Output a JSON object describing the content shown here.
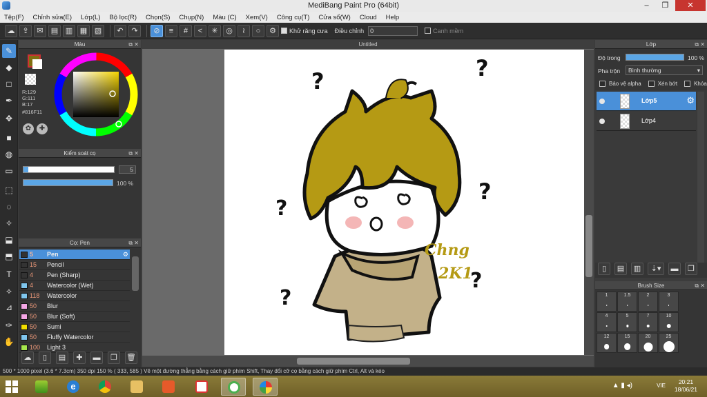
{
  "window": {
    "title": "MediBang Paint Pro (64bit)",
    "minimize": "–",
    "maximize": "❐",
    "close": "✕"
  },
  "menu": [
    "Tệp(F)",
    "Chỉnh sửa(E)",
    "Lớp(L)",
    "Bộ lọc(R)",
    "Chọn(S)",
    "Chụp(N)",
    "Màu (C)",
    "Xem(V)",
    "Công cụ(T)",
    "Cửa sổ(W)",
    "Cloud",
    "Help"
  ],
  "toolbar": {
    "antialias_label": "Khử răng cưa",
    "adjust_label": "Điều chỉnh",
    "adjust_value": "0",
    "smooth_label": "Canh mềm"
  },
  "color_panel": {
    "title": "Màu",
    "r": "R:129",
    "g": "G:111",
    "b": "B:17",
    "hex": "#816F11",
    "fg_color": "#816F11"
  },
  "brush_control": {
    "title": "Kiểm soát cọ",
    "size_value": "5",
    "opacity_value": "100 %",
    "size_fraction": 0.05,
    "opacity_fraction": 1.0
  },
  "brush_list": {
    "title": "Cọ: Pen",
    "items": [
      {
        "size": "5",
        "name": "Pen",
        "color": "#333333"
      },
      {
        "size": "15",
        "name": "Pencil",
        "color": "#333333"
      },
      {
        "size": "4",
        "name": "Pen (Sharp)",
        "color": "#333333"
      },
      {
        "size": "4",
        "name": "Watercolor (Wet)",
        "color": "#7fc6ee"
      },
      {
        "size": "118",
        "name": "Watercolor",
        "color": "#7fc6ee"
      },
      {
        "size": "50",
        "name": "Blur",
        "color": "#f4a6e6"
      },
      {
        "size": "50",
        "name": "Blur (Soft)",
        "color": "#f4a6e6"
      },
      {
        "size": "50",
        "name": "Sumi",
        "color": "#f2e000"
      },
      {
        "size": "50",
        "name": "Fluffy Watercolor",
        "color": "#7fc6ee"
      },
      {
        "size": "100",
        "name": "Light 3",
        "color": "#a7e64d"
      }
    ]
  },
  "canvas": {
    "tab_title": "Untitled",
    "signature_text": "Chng 2K1"
  },
  "layer_panel": {
    "title": "Lớp",
    "opacity_label": "Độ trong",
    "opacity_value": "100 %",
    "opacity_fraction": 1.0,
    "blend_label": "Pha trộn",
    "blend_value": "Bình thường",
    "protect_alpha": "Bảo vệ alpha",
    "clipping": "Xén bớt",
    "lock": "Khóa",
    "layers": [
      "Lớp5",
      "Lớp4"
    ]
  },
  "brush_size_panel": {
    "title": "Brush Size",
    "sizes": [
      "1",
      "1.5",
      "2",
      "3",
      "4",
      "5",
      "7",
      "10",
      "12",
      "15",
      "20",
      "25"
    ]
  },
  "statusbar": {
    "text": "500 * 1000 pixel   (3.6 * 7.3cm)   350 dpi   150 %   ( 333, 585 )  Vẽ một đường thẳng bằng cách giữ phím Shift, Thay đổi cỡ cọ bằng cách giữ phím Ctrl, Alt và kéo"
  },
  "taskbar": {
    "lang": "VIE",
    "time": "20:21",
    "date": "18/06/21"
  },
  "colors": {
    "accent": "#4a90d9",
    "hair": "#b59a14",
    "shirt": "#c3b189",
    "blush": "#f4b6b6"
  }
}
